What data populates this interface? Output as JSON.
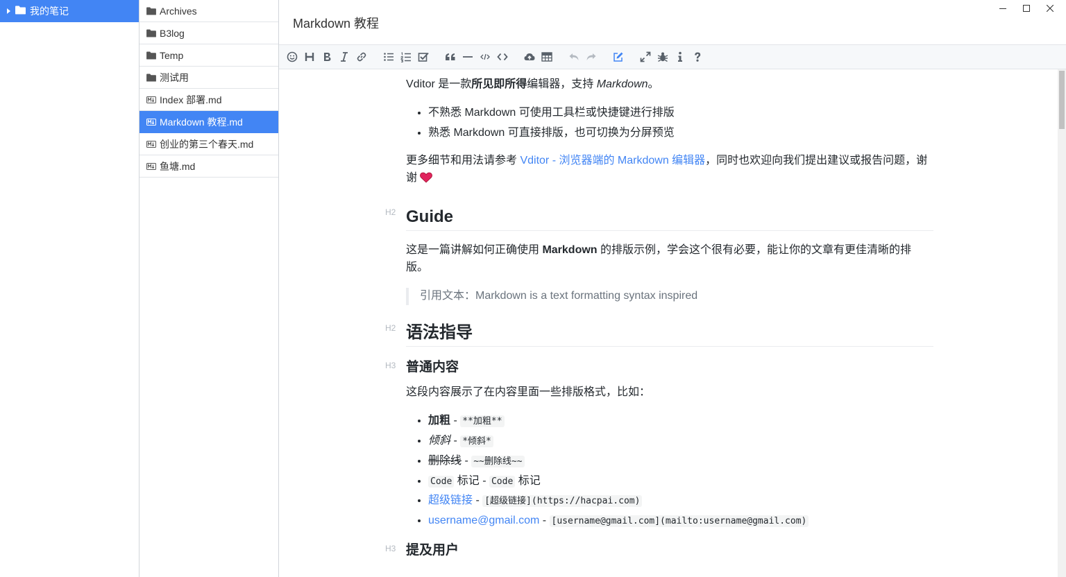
{
  "notebook": {
    "label": "我的笔记"
  },
  "files": [
    {
      "name": "Archives",
      "type": "folder"
    },
    {
      "name": "B3log",
      "type": "folder"
    },
    {
      "name": "Temp",
      "type": "folder"
    },
    {
      "name": "测试用",
      "type": "folder"
    },
    {
      "name": "Index 部署.md",
      "type": "md"
    },
    {
      "name": "Markdown 教程.md",
      "type": "md",
      "active": true
    },
    {
      "name": "创业的第三个春天.md",
      "type": "md"
    },
    {
      "name": "鱼塘.md",
      "type": "md"
    }
  ],
  "editor": {
    "title": "Markdown 教程",
    "window_controls": {
      "minimize": "—",
      "maximize": "☐",
      "close": "✕"
    }
  },
  "toolbar_icons": [
    "emoji-icon",
    "headings-icon",
    "bold-icon",
    "italic-icon",
    "link-icon",
    "list-icon",
    "ordered-list-icon",
    "check-icon",
    "quote-icon",
    "line-icon",
    "inline-code-icon",
    "code-block-icon",
    "upload-icon",
    "table-icon",
    "undo-icon",
    "redo-icon",
    "edit-mode-icon",
    "fullscreen-icon",
    "devtools-icon",
    "info-icon",
    "help-icon"
  ],
  "doc": {
    "intro": {
      "before": "Vditor 是一款",
      "bold": "所见即所得",
      "middle": "编辑器，支持 ",
      "italic": "Markdown",
      "after": "。"
    },
    "bullets1": [
      "不熟悉 Markdown 可使用工具栏或快捷键进行排版",
      "熟悉 Markdown 可直接排版，也可切换为分屏预览"
    ],
    "more": {
      "before": "更多细节和用法请参考 ",
      "link": "Vditor - 浏览器端的 Markdown 编辑器",
      "after": "，同时也欢迎向我们提出建议或报告问题，谢谢"
    },
    "h_guide": {
      "mark": "H2",
      "text": "Guide"
    },
    "guide_p": {
      "before": "这是一篇讲解如何正确使用 ",
      "bold": "Markdown",
      "after": " 的排版示例，学会这个很有必要，能让你的文章有更佳清晰的排版。"
    },
    "quote": "引用文本：Markdown is a text formatting syntax inspired",
    "h_syntax": {
      "mark": "H2",
      "text": "语法指导"
    },
    "h_normal": {
      "mark": "H3",
      "text": "普通内容"
    },
    "normal_p": "这段内容展示了在内容里面一些排版格式，比如：",
    "formats": {
      "bold": {
        "label": "加粗",
        "sep": " - ",
        "code": "**加粗**"
      },
      "italic": {
        "label": "倾斜",
        "sep": " - ",
        "code": "*倾斜*"
      },
      "strike": {
        "label": "删除线",
        "sep": " - ",
        "code": "~~删除线~~"
      },
      "codemark": {
        "code1": "Code",
        "label1": " 标记",
        "sep": " - ",
        "code2": "Code",
        "label2": " 标记"
      },
      "link": {
        "label": "超级链接",
        "sep": " - ",
        "code": "[超级链接](https://hacpai.com)"
      },
      "mail": {
        "label": "username@gmail.com",
        "sep": " - ",
        "code": "[username@gmail.com](mailto:username@gmail.com)"
      }
    },
    "h_mention": {
      "mark": "H3",
      "text": "提及用户"
    }
  },
  "colors": {
    "accent": "#4285f4",
    "heart": "#e0245e"
  }
}
